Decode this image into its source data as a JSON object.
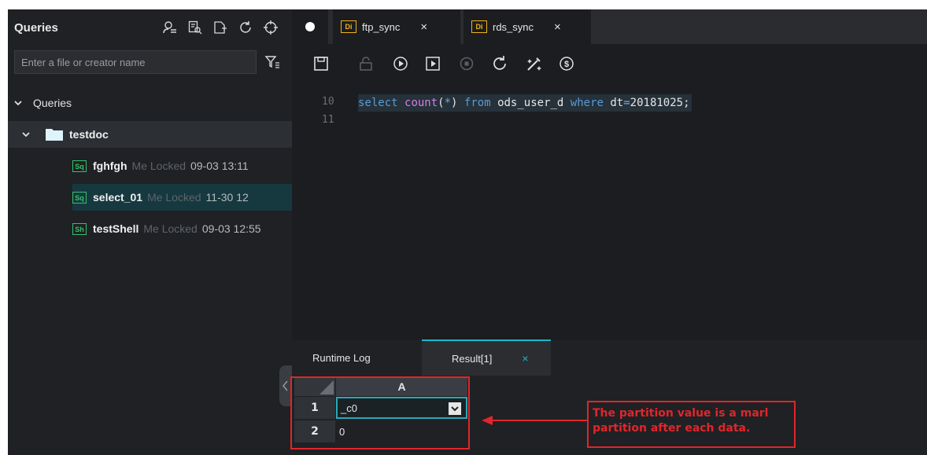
{
  "sidebar": {
    "title": "Queries",
    "search_placeholder": "Enter a file or creator name",
    "root_label": "Queries",
    "folder_label": "testdoc",
    "files": [
      {
        "badge": "Sq",
        "name": "fghfgh",
        "meta": "Me Locked",
        "time": "09-03 13:11"
      },
      {
        "badge": "Sq",
        "name": "select_01",
        "meta": "Me Locked",
        "time": "11-30 12"
      },
      {
        "badge": "Sh",
        "name": "testShell",
        "meta": "Me Locked",
        "time": "09-03 12:55"
      }
    ]
  },
  "tabs": [
    {
      "badge": "Di",
      "label": "ftp_sync",
      "close": "×"
    },
    {
      "badge": "Di",
      "label": "rds_sync",
      "close": "×"
    }
  ],
  "editor": {
    "line_numbers": [
      "10",
      "11"
    ],
    "code": {
      "t1": "select ",
      "t2": "count",
      "t3": "(",
      "t4": "*",
      "t5": ") ",
      "t6": "from ",
      "t7": "ods_user_d ",
      "t8": "where ",
      "t9": "dt",
      "t10": "=",
      "t11": "20181025;"
    }
  },
  "results": {
    "tabs": [
      {
        "label": "Runtime Log"
      },
      {
        "label": "Result[1]",
        "close": "×"
      }
    ],
    "column_header": "A",
    "rows": [
      {
        "num": "1",
        "value": "_c0"
      },
      {
        "num": "2",
        "value": "0"
      }
    ]
  },
  "annotation": {
    "text": "The partition value is a marl partition after each data."
  },
  "colors": {
    "accent_teal": "#19b8c8",
    "badge_green": "#36c06a",
    "badge_orange": "#f2b21b",
    "annotation_red": "#e0262b"
  }
}
